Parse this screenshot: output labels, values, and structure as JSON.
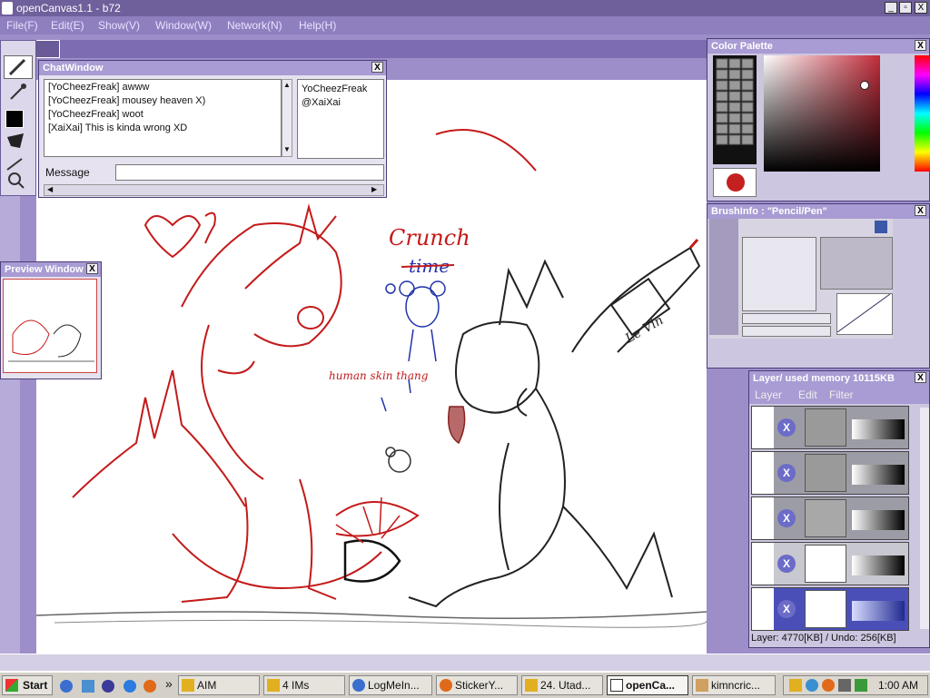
{
  "app": {
    "title": "openCanvas1.1 - b72",
    "window_controls": {
      "minimize": "_",
      "maximize": "▫",
      "close": "X"
    }
  },
  "menu": [
    "File(F)",
    "Edit(E)",
    "Show(V)",
    "Window(W)",
    "Network(N)",
    "Help(H)"
  ],
  "chat_window": {
    "title": "ChatWindow",
    "close": "X",
    "messages": [
      "[YoCheezFreak] awww",
      "[YoCheezFreak] mousey heaven X)",
      "[YoCheezFreak] woot",
      "[XaiXai] This is kinda wrong XD"
    ],
    "users": [
      "YoCheezFreak",
      "@XaiXai"
    ],
    "message_label": "Message",
    "message_value": ""
  },
  "preview_window": {
    "title": "Preview Window",
    "close": "X"
  },
  "color_palette": {
    "title": "Color Palette",
    "close": "X",
    "current_color": "#c42020",
    "hue_color": "#c22c3a"
  },
  "brush_info": {
    "title": "BrushInfo : \"Pencil/Pen\"",
    "close": "X"
  },
  "layer_panel": {
    "title": "Layer/ used memory 10115KB",
    "close": "X",
    "menu": [
      "Layer",
      "Edit",
      "Filter"
    ],
    "delete_glyph": "X",
    "status": "Layer: 4770[KB] / Undo: 256[KB]"
  },
  "canvas_text": {
    "crunch": "Crunch",
    "time": "time",
    "human_skin": "human skin thang",
    "le_vin": "Le Vin"
  },
  "taskbar": {
    "start": "Start",
    "overflow": "»",
    "buttons": [
      "AIM",
      "4 IMs",
      "LogMeIn...",
      "StickerY...",
      "24. Utad...",
      "openCa...",
      "kimncric..."
    ],
    "active_index": 5,
    "clock": "1:00 AM"
  },
  "colors": {
    "title_bar": "#6f5f9b",
    "menu_bar": "#8f7fbf",
    "panel_title": "#a99bd3",
    "workspace": "#9d8ec9",
    "ink_red": "#c41a1a",
    "ink_blue": "#2233aa"
  }
}
